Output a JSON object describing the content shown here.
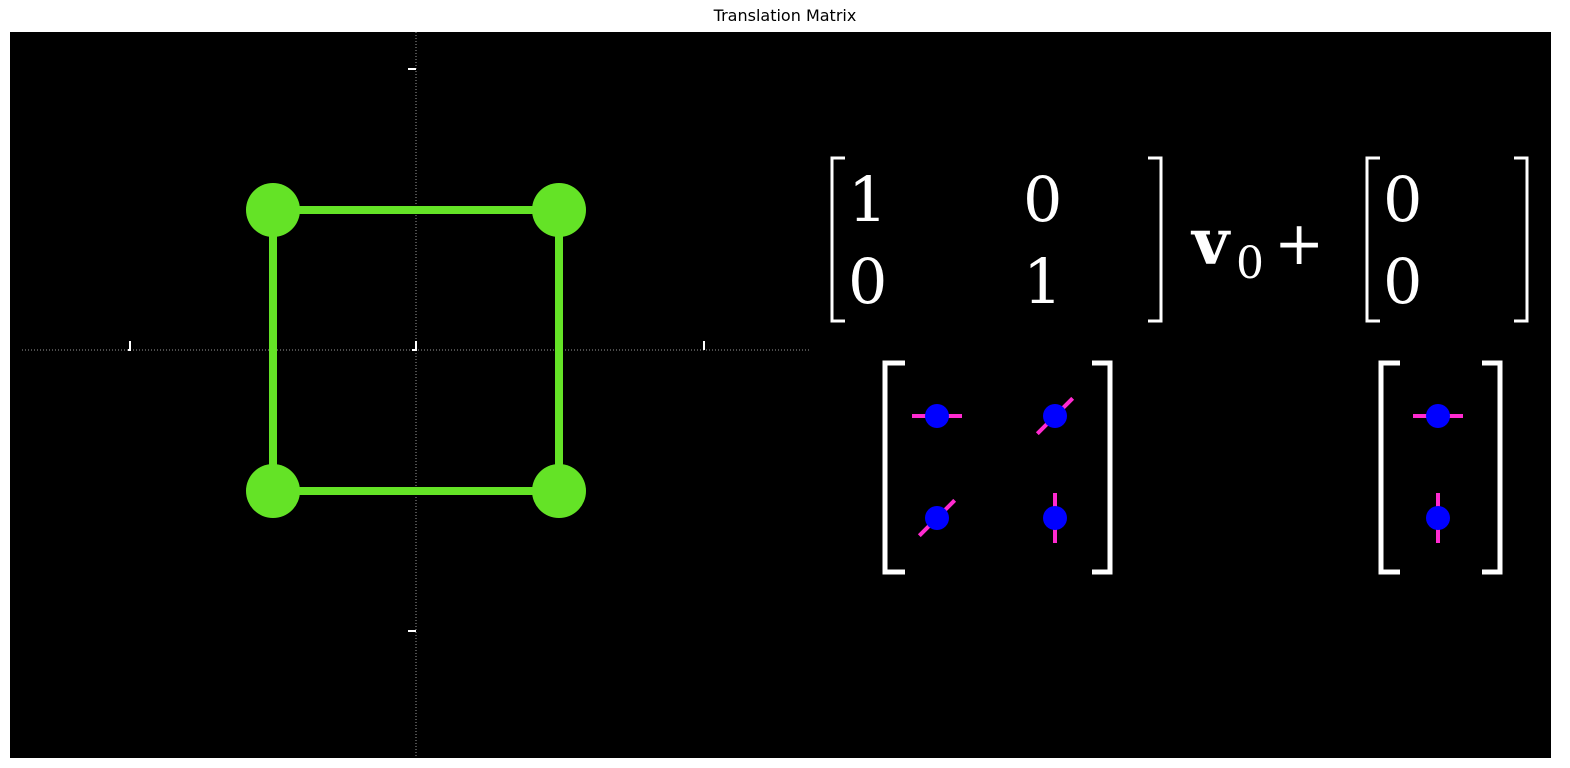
{
  "figure": {
    "title": "Translation Matrix"
  },
  "colors": {
    "background": "#000000",
    "shape": "#64e326",
    "axis": "#9a9a9a",
    "tick": "#ffffff",
    "knob_fill": "#0000ff",
    "knob_stroke": "#ff2ad0",
    "text": "#ffffff"
  },
  "equation": {
    "matrix": [
      [
        "1",
        "0"
      ],
      [
        "0",
        "1"
      ]
    ],
    "vector_symbol": "v",
    "vector_subscript": "0",
    "operator": "+",
    "translation": [
      "0",
      "0"
    ]
  },
  "matrix_knobs": [
    {
      "name": "knob-m00",
      "angle_deg": 0
    },
    {
      "name": "knob-m01",
      "angle_deg": -45
    },
    {
      "name": "knob-m10",
      "angle_deg": -45
    },
    {
      "name": "knob-m11",
      "angle_deg": 90
    }
  ],
  "translation_knobs": [
    {
      "name": "knob-t0",
      "angle_deg": 0
    },
    {
      "name": "knob-t1",
      "angle_deg": 90
    }
  ]
}
